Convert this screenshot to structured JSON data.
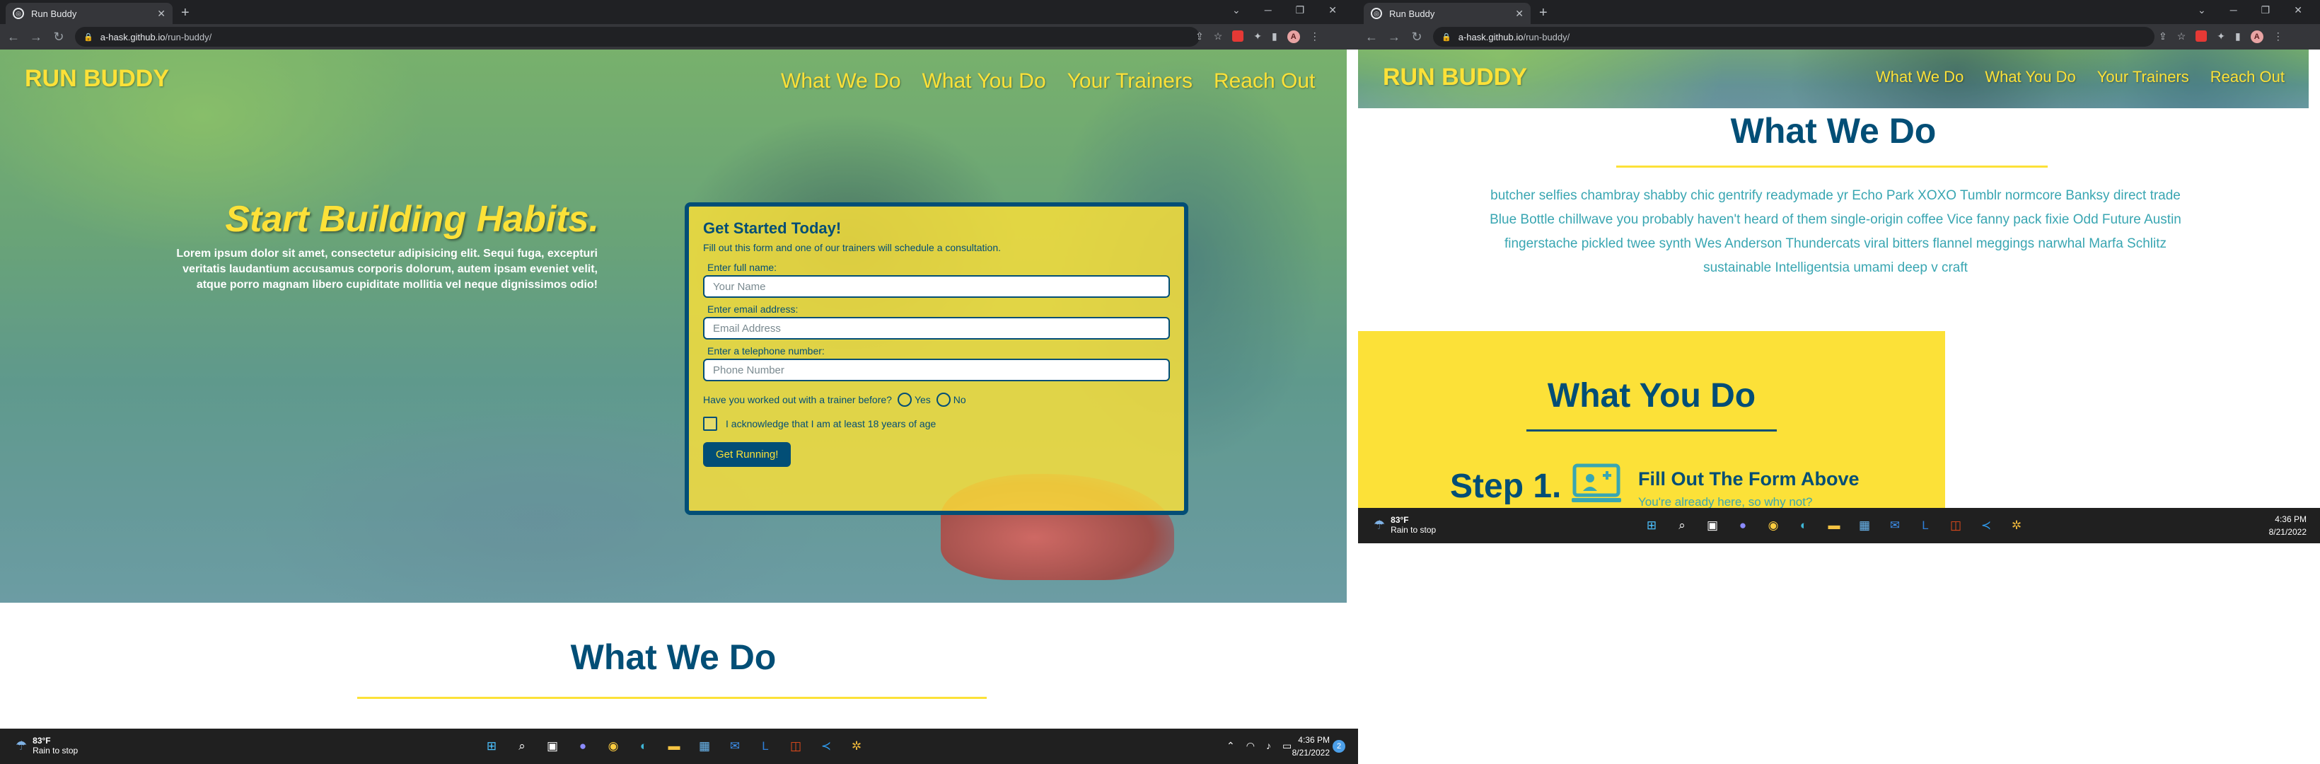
{
  "left": {
    "browser": {
      "tab_title": "Run Buddy",
      "url_host": "a-hask.github.io",
      "url_path": "/run-buddy/"
    },
    "site": {
      "brand": "RUN BUDDY",
      "nav": [
        "What We Do",
        "What You Do",
        "Your Trainers",
        "Reach Out"
      ],
      "hero_title": "Start Building Habits.",
      "hero_text": "Lorem ipsum dolor sit amet, consectetur adipisicing elit. Sequi fuga, excepturi veritatis laudantium accusamus corporis dolorum, autem ipsam eveniet velit, atque porro magnam libero cupiditate mollitia vel neque dignissimos odio!",
      "form": {
        "title": "Get Started Today!",
        "subtitle": "Fill out this form and one of our trainers will schedule a consultation.",
        "name_label": "Enter full name:",
        "name_placeholder": "Your Name",
        "email_label": "Enter email address:",
        "email_placeholder": "Email Address",
        "phone_label": "Enter a telephone number:",
        "phone_placeholder": "Phone Number",
        "trainer_question": "Have you worked out with a trainer before?",
        "yes": "Yes",
        "no": "No",
        "acknowledge": "I acknowledge that I am at least 18 years of age",
        "submit": "Get Running!"
      },
      "section_title": "What We Do"
    },
    "taskbar": {
      "temp": "83°F",
      "weather": "Rain to stop",
      "time": "4:36 PM",
      "date": "8/21/2022",
      "notif_count": "2"
    }
  },
  "right": {
    "browser": {
      "tab_title": "Run Buddy",
      "url_host": "a-hask.github.io",
      "url_path": "/run-buddy/"
    },
    "site": {
      "brand": "RUN BUDDY",
      "nav": [
        "What We Do",
        "What You Do",
        "Your Trainers",
        "Reach Out"
      ],
      "what_we_do_title": "What We Do",
      "what_we_do_text": "butcher selfies chambray shabby chic gentrify readymade yr Echo Park XOXO Tumblr normcore Banksy direct trade Blue Bottle chillwave you probably haven't heard of them single-origin coffee Vice fanny pack fixie Odd Future Austin fingerstache pickled twee synth Wes Anderson Thundercats viral bitters flannel meggings narwhal Marfa Schlitz sustainable Intelligentsia umami deep v craft",
      "what_you_do_title": "What You Do",
      "step_label": "Step 1.",
      "step_title": "Fill Out The Form Above",
      "step_link": "You're already here, so why not?"
    },
    "taskbar": {
      "temp": "83°F",
      "weather": "Rain to stop",
      "time": "4:36 PM",
      "date": "8/21/2022"
    }
  },
  "colors": {
    "primary": "#024e76",
    "accent": "#fce138",
    "secondary": "#39a6b2"
  }
}
